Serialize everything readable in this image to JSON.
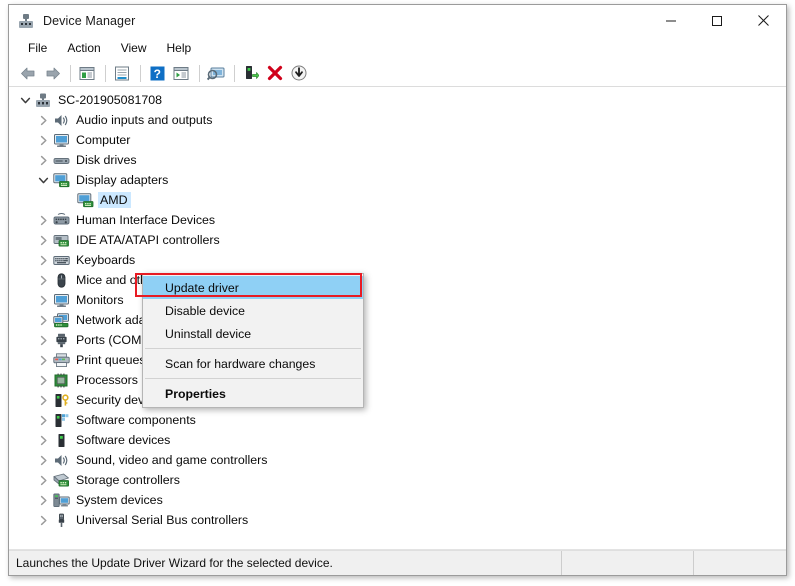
{
  "window": {
    "title": "Device Manager",
    "title_icon": "device-manager-icon",
    "minimize_label": "─",
    "maximize_label": "□",
    "close_label": "✕"
  },
  "menubar": {
    "items": [
      {
        "label": "File",
        "name": "menu-file"
      },
      {
        "label": "Action",
        "name": "menu-action"
      },
      {
        "label": "View",
        "name": "menu-view"
      },
      {
        "label": "Help",
        "name": "menu-help"
      }
    ]
  },
  "toolbar": {
    "buttons": [
      {
        "name": "back-button",
        "icon": "back-arrow-icon",
        "tooltip": "Back"
      },
      {
        "name": "forward-button",
        "icon": "forward-arrow-icon",
        "tooltip": "Forward"
      },
      {
        "name": "show-hide-console-tree-button",
        "icon": "console-tree-icon",
        "tooltip": "Show/hide console tree"
      },
      {
        "name": "properties-button",
        "icon": "properties-window-icon",
        "tooltip": "Properties"
      },
      {
        "name": "help-button",
        "icon": "help-question-icon",
        "tooltip": "Help"
      },
      {
        "name": "view-button",
        "icon": "view-list-icon",
        "tooltip": "View"
      },
      {
        "name": "scan-hardware-changes-button",
        "icon": "scan-monitor-icon",
        "tooltip": "Scan for hardware changes"
      },
      {
        "name": "update-driver-button",
        "icon": "update-driver-icon",
        "tooltip": "Update driver"
      },
      {
        "name": "uninstall-device-button",
        "icon": "red-x-icon",
        "tooltip": "Uninstall device"
      },
      {
        "name": "disable-device-button",
        "icon": "down-arrow-circle-icon",
        "tooltip": "Disable device"
      }
    ]
  },
  "tree": {
    "nodes": [
      {
        "label": "SC-201905081708",
        "level": 0,
        "expander": "expanded",
        "icon": "computer-root-icon",
        "name": "tree-node-root",
        "selected": false
      },
      {
        "label": "Audio inputs and outputs",
        "level": 1,
        "expander": "collapsed",
        "icon": "speaker-icon",
        "name": "tree-node-audio-inputs-and-outputs",
        "selected": false
      },
      {
        "label": "Computer",
        "level": 1,
        "expander": "collapsed",
        "icon": "monitor-icon",
        "name": "tree-node-computer",
        "selected": false
      },
      {
        "label": "Disk drives",
        "level": 1,
        "expander": "collapsed",
        "icon": "disk-drive-icon",
        "name": "tree-node-disk-drives",
        "selected": false
      },
      {
        "label": "Display adapters",
        "level": 1,
        "expander": "expanded",
        "icon": "display-adapter-icon",
        "name": "tree-node-display-adapters",
        "selected": false
      },
      {
        "label": "AMD",
        "level": 2,
        "expander": "none",
        "icon": "display-adapter-icon",
        "name": "tree-node-amd-display-adapter",
        "selected": true
      },
      {
        "label": "Human Interface Devices",
        "level": 1,
        "expander": "collapsed",
        "icon": "hid-icon",
        "name": "tree-node-human-interface-devices",
        "selected": false
      },
      {
        "label": "IDE ATA/ATAPI controllers",
        "level": 1,
        "expander": "collapsed",
        "icon": "ide-controller-icon",
        "name": "tree-node-ide-ata-atapi-controllers",
        "selected": false
      },
      {
        "label": "Keyboards",
        "level": 1,
        "expander": "collapsed",
        "icon": "keyboard-icon",
        "name": "tree-node-keyboards",
        "selected": false
      },
      {
        "label": "Mice and other pointing devices",
        "level": 1,
        "expander": "collapsed",
        "icon": "mouse-icon",
        "name": "tree-node-mice-and-other-pointing-devices",
        "selected": false
      },
      {
        "label": "Monitors",
        "level": 1,
        "expander": "collapsed",
        "icon": "monitor-icon",
        "name": "tree-node-monitors",
        "selected": false
      },
      {
        "label": "Network adapters",
        "level": 1,
        "expander": "collapsed",
        "icon": "network-adapter-icon",
        "name": "tree-node-network-adapters",
        "selected": false
      },
      {
        "label": "Ports (COM & LPT)",
        "level": 1,
        "expander": "collapsed",
        "icon": "port-connector-icon",
        "name": "tree-node-ports-com-and-lpt",
        "selected": false
      },
      {
        "label": "Print queues",
        "level": 1,
        "expander": "collapsed",
        "icon": "printer-icon",
        "name": "tree-node-print-queues",
        "selected": false
      },
      {
        "label": "Processors",
        "level": 1,
        "expander": "collapsed",
        "icon": "processor-chip-icon",
        "name": "tree-node-processors",
        "selected": false
      },
      {
        "label": "Security devices",
        "level": 1,
        "expander": "collapsed",
        "icon": "security-key-icon",
        "name": "tree-node-security-devices",
        "selected": false
      },
      {
        "label": "Software components",
        "level": 1,
        "expander": "collapsed",
        "icon": "software-component-icon",
        "name": "tree-node-software-components",
        "selected": false
      },
      {
        "label": "Software devices",
        "level": 1,
        "expander": "collapsed",
        "icon": "software-device-icon",
        "name": "tree-node-software-devices",
        "selected": false
      },
      {
        "label": "Sound, video and game controllers",
        "level": 1,
        "expander": "collapsed",
        "icon": "speaker-icon",
        "name": "tree-node-sound-video-and-game-controllers",
        "selected": false
      },
      {
        "label": "Storage controllers",
        "level": 1,
        "expander": "collapsed",
        "icon": "storage-controller-icon",
        "name": "tree-node-storage-controllers",
        "selected": false
      },
      {
        "label": "System devices",
        "level": 1,
        "expander": "collapsed",
        "icon": "system-device-icon",
        "name": "tree-node-system-devices",
        "selected": false
      },
      {
        "label": "Universal Serial Bus controllers",
        "level": 1,
        "expander": "collapsed",
        "icon": "usb-icon",
        "name": "tree-node-universal-serial-bus-controllers",
        "selected": false
      }
    ]
  },
  "context_menu": {
    "items": [
      {
        "label": "Update driver",
        "name": "context-menu-update-driver",
        "highlighted": true,
        "bold": false
      },
      {
        "label": "Disable device",
        "name": "context-menu-disable-device",
        "highlighted": false,
        "bold": false
      },
      {
        "label": "Uninstall device",
        "name": "context-menu-uninstall-device",
        "highlighted": false,
        "bold": false
      },
      {
        "separator": true
      },
      {
        "label": "Scan for hardware changes",
        "name": "context-menu-scan-for-hardware-changes",
        "highlighted": false,
        "bold": false
      },
      {
        "separator": true
      },
      {
        "label": "Properties",
        "name": "context-menu-properties",
        "highlighted": false,
        "bold": true
      }
    ],
    "highlight_color": "#8fd0f5",
    "annotation_border_color": "#e81b23"
  },
  "statusbar": {
    "message": "Launches the Update Driver Wizard for the selected device.",
    "pane2": "",
    "pane3": ""
  }
}
